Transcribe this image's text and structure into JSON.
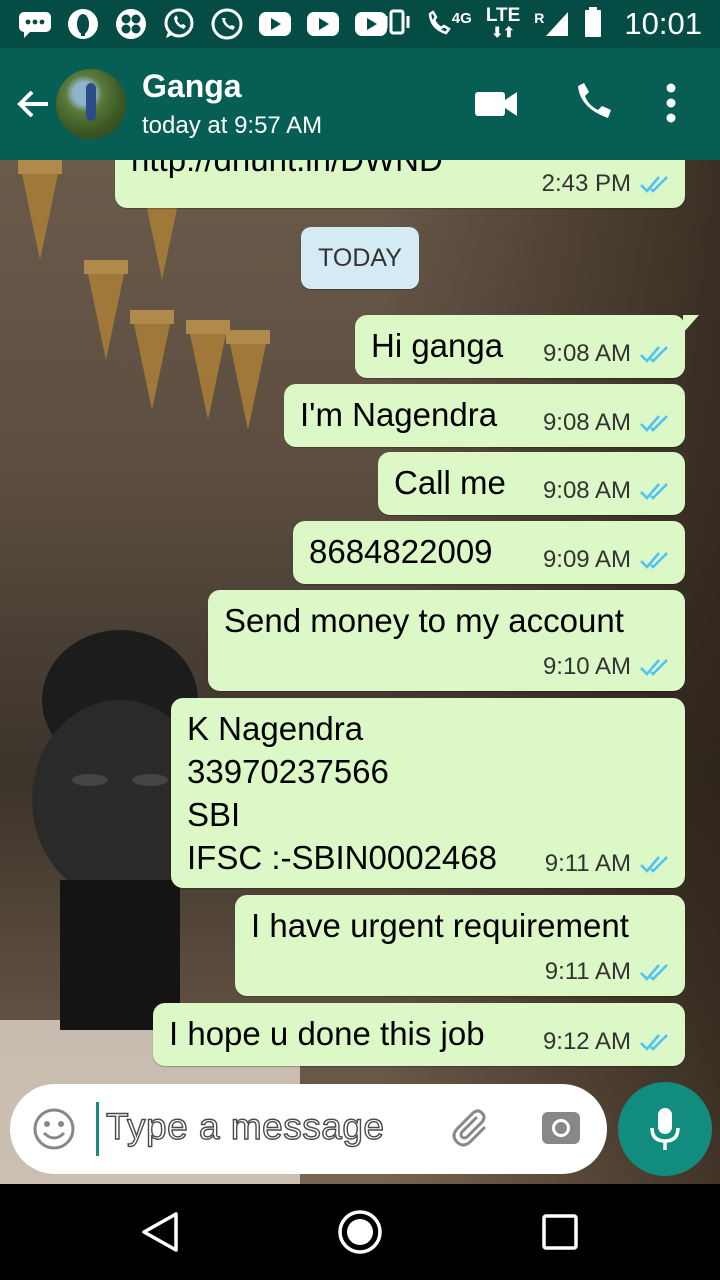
{
  "status_bar": {
    "network_small": "4G",
    "network_lte": "LTE",
    "roaming": "R",
    "time": "10:01",
    "notification_icons": [
      "messages-icon",
      "opera-icon",
      "app-icon",
      "whatsapp-icon",
      "call-icon",
      "youtube-icon",
      "youtube-icon",
      "youtube-icon"
    ]
  },
  "header": {
    "contact_name": "Ganga",
    "last_seen": "today at 9:57 AM"
  },
  "chat": {
    "partial_message": {
      "text": "http://dhunt.in/DWND",
      "time": "2:43 PM"
    },
    "date_chip": "TODAY",
    "messages": [
      {
        "text": "Hi ganga",
        "time": "9:08 AM",
        "status": "read"
      },
      {
        "text": "I'm Nagendra",
        "time": "9:08 AM",
        "status": "read"
      },
      {
        "text": "Call me",
        "time": "9:08 AM",
        "status": "read"
      },
      {
        "text": "8684822009",
        "time": "9:09 AM",
        "status": "read"
      },
      {
        "text": "Send money to my account",
        "time": "9:10 AM",
        "status": "read"
      },
      {
        "text": "K Nagendra\n33970237566\nSBI\nIFSC :-SBIN0002468",
        "time": "9:11 AM",
        "status": "read"
      },
      {
        "text": "I have urgent requirement",
        "time": "9:11 AM",
        "status": "read"
      },
      {
        "text": "I hope u done this job",
        "time": "9:12 AM",
        "status": "read"
      }
    ]
  },
  "composer": {
    "placeholder": "Type a message"
  },
  "colors": {
    "status_bar": "#054d44",
    "app_bar": "#075e54",
    "outgoing_bubble": "#dcf8c6",
    "read_tick": "#4fc3f7",
    "mic_button": "#128c7e"
  }
}
